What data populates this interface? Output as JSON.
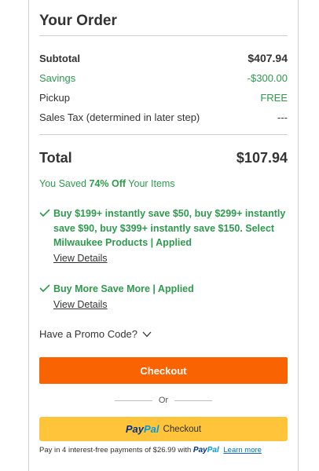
{
  "order": {
    "title": "Your Order",
    "subtotal_label": "Subtotal",
    "subtotal_value": "$407.94",
    "savings_label": "Savings",
    "savings_value": "-$300.00",
    "pickup_label": "Pickup",
    "pickup_value": "FREE",
    "tax_label": "Sales Tax (determined in later step)",
    "tax_value": "---",
    "total_label": "Total",
    "total_value": "$107.94",
    "saved_prefix": "You Saved",
    "saved_percent": "74% Off",
    "saved_suffix": "Your Items"
  },
  "promotions": [
    {
      "text": "Buy $199+ instantly save $50, buy $299+ instantly save $90, buy $399+ instantly save $150. Select Milwaukee Products | Applied",
      "link": "View Details"
    },
    {
      "text": "Buy More Save More | Applied",
      "link": "View Details"
    }
  ],
  "promo_code_label": "Have a Promo Code?",
  "checkout_label": "Checkout",
  "or_label": "Or",
  "paypal": {
    "logo_pay": "Pay",
    "logo_pal": "Pal",
    "button_label": "Checkout",
    "payin_text": "Pay in 4 interest-free payments of $26.99 with",
    "learn_more": "Learn more"
  },
  "colors": {
    "accent_orange": "#f96302",
    "savings_green": "#2e9a4e",
    "paypal_yellow": "#ffc439",
    "paypal_dark_blue": "#003087",
    "paypal_light_blue": "#009cde"
  },
  "icons": {
    "check": "check-icon",
    "chevron": "chevron-down-icon"
  }
}
